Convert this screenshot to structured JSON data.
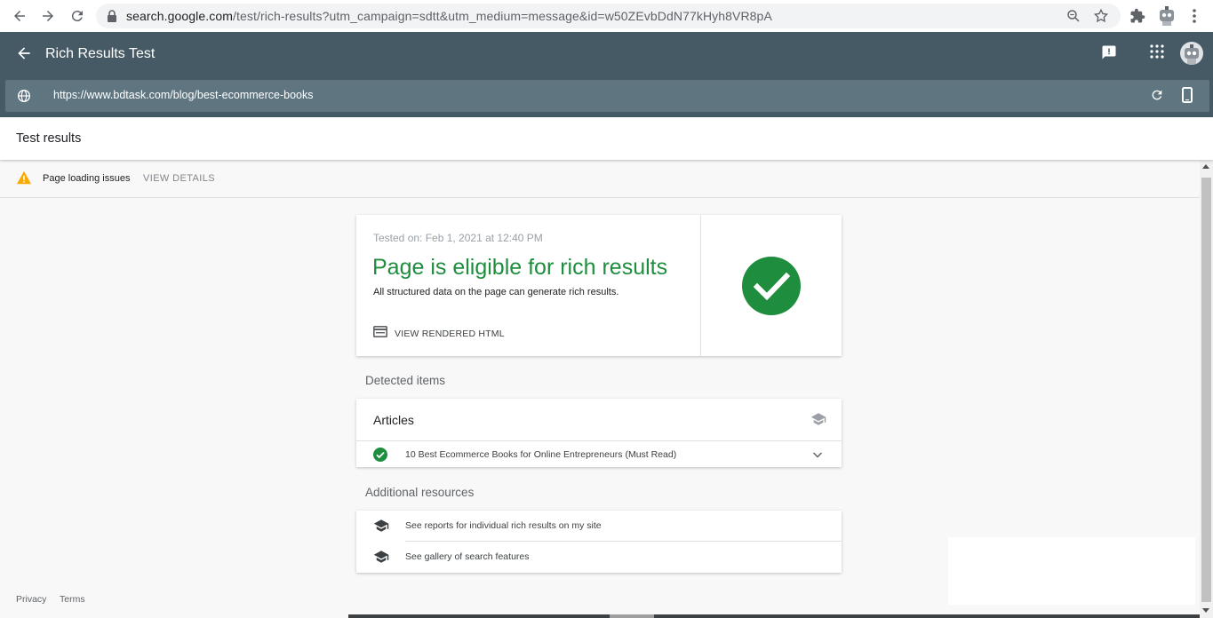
{
  "browser": {
    "url_host": "search.google.com",
    "url_path": "/test/rich-results?utm_campaign=sdtt&utm_medium=message&id=w50ZEvbDdN77kHyh8VR8pA",
    "icons": [
      "back-arrow-icon",
      "forward-arrow-icon",
      "reload-icon",
      "lock-icon",
      "zoom-icon",
      "star-icon",
      "extensions-icon",
      "profile-icon",
      "menu-icon"
    ]
  },
  "app": {
    "title": "Rich Results Test",
    "tested_url": "https://www.bdtask.com/blog/best-ecommerce-books",
    "header_color": "#455a64"
  },
  "results": {
    "header": "Test results",
    "warning_text": "Page loading issues",
    "warning_action": "VIEW DETAILS",
    "tested_on": "Tested on: Feb 1, 2021 at 12:40 PM",
    "status_title": "Page is eligible for rich results",
    "status_desc": "All structured data on the page can generate rich results.",
    "view_html": "VIEW RENDERED HTML",
    "status_color": "#1e8e3e"
  },
  "detected": {
    "label": "Detected items",
    "group_title": "Articles",
    "items": [
      {
        "text": "10 Best Ecommerce Books for Online Entrepreneurs (Must Read)"
      }
    ]
  },
  "resources": {
    "label": "Additional resources",
    "items": [
      {
        "text": "See reports for individual rich results on my site"
      },
      {
        "text": "See gallery of search features"
      }
    ]
  },
  "footer": {
    "privacy": "Privacy",
    "terms": "Terms"
  }
}
